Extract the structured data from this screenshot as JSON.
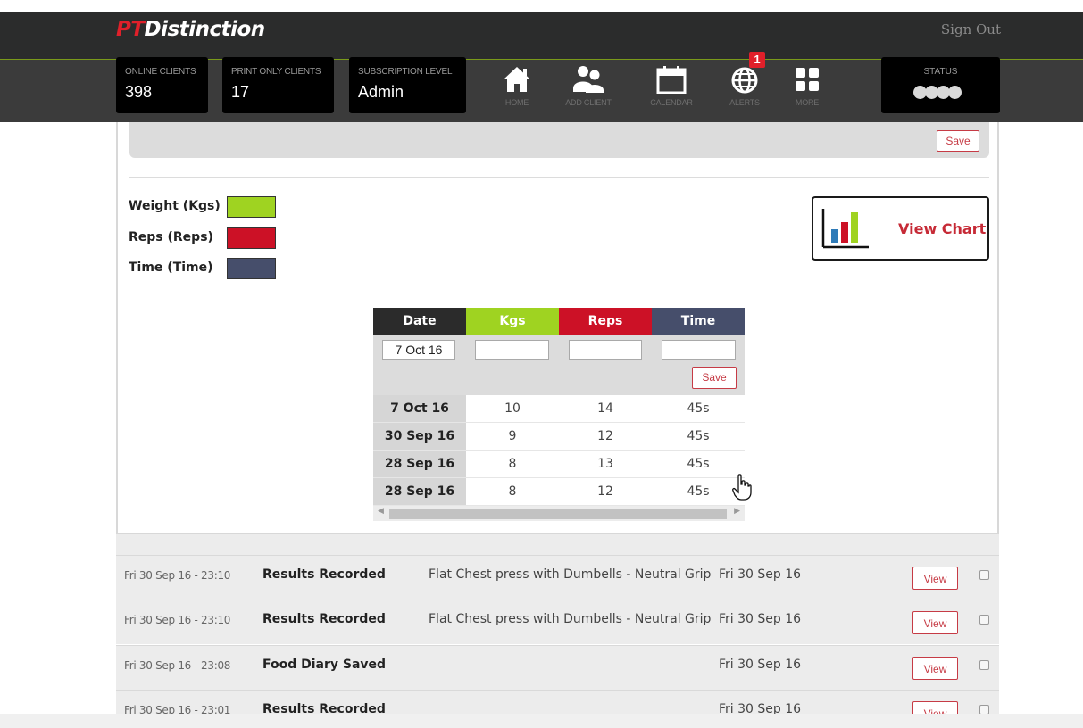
{
  "header": {
    "logo_pt": "PT",
    "logo_rest": "Distinction",
    "signout": "Sign Out",
    "stats": [
      {
        "label": "ONLINE CLIENTS",
        "value": "398"
      },
      {
        "label": "PRINT ONLY CLIENTS",
        "value": "17"
      },
      {
        "label": "SUBSCRIPTION LEVEL",
        "value": "Admin"
      }
    ],
    "nav": [
      {
        "label": "HOME",
        "icon": "home-icon"
      },
      {
        "label": "ADD CLIENT",
        "icon": "users-icon"
      },
      {
        "label": "CALENDAR",
        "icon": "calendar-icon"
      },
      {
        "label": "ALERTS",
        "icon": "globe-icon",
        "badge": "1"
      },
      {
        "label": "MORE",
        "icon": "grid-icon"
      }
    ],
    "status_label": "STATUS"
  },
  "panel": {
    "top_save": "Save",
    "legend": [
      {
        "label": "Weight (Kgs)",
        "color": "#9fd321"
      },
      {
        "label": "Reps (Reps)",
        "color": "#cc1126"
      },
      {
        "label": "Time (Time)",
        "color": "#464e6b"
      }
    ],
    "view_chart": "View Chart",
    "table": {
      "headers": [
        {
          "label": "Date",
          "color": "#2b2b2b"
        },
        {
          "label": "Kgs",
          "color": "#9fd321"
        },
        {
          "label": "Reps",
          "color": "#cc1126"
        },
        {
          "label": "Time",
          "color": "#464e6b"
        }
      ],
      "inputs": {
        "date": "7 Oct 16",
        "kgs": "",
        "reps": "",
        "time": ""
      },
      "save": "Save",
      "rows": [
        {
          "date": "7 Oct 16",
          "kgs": "10",
          "reps": "14",
          "time": "45s"
        },
        {
          "date": "30 Sep 16",
          "kgs": "9",
          "reps": "12",
          "time": "45s"
        },
        {
          "date": "28 Sep 16",
          "kgs": "8",
          "reps": "13",
          "time": "45s"
        },
        {
          "date": "28 Sep 16",
          "kgs": "8",
          "reps": "12",
          "time": "45s"
        }
      ]
    }
  },
  "activity": [
    {
      "timestamp": "Fri 30 Sep 16 - 23:10",
      "type": "Results Recorded",
      "description": "Flat Chest press with Dumbells - Neutral Grip",
      "date": "Fri 30 Sep 16",
      "action": "View"
    },
    {
      "timestamp": "Fri 30 Sep 16 - 23:10",
      "type": "Results Recorded",
      "description": "Flat Chest press with Dumbells - Neutral Grip",
      "date": "Fri 30 Sep 16",
      "action": "View"
    },
    {
      "timestamp": "Fri 30 Sep 16 - 23:08",
      "type": "Food Diary Saved",
      "description": "",
      "date": "Fri 30 Sep 16",
      "action": "View"
    },
    {
      "timestamp": "Fri 30 Sep 16 - 23:01",
      "type": "Results Recorded",
      "description": "",
      "date": "Fri 30 Sep 16",
      "action": "View"
    }
  ]
}
